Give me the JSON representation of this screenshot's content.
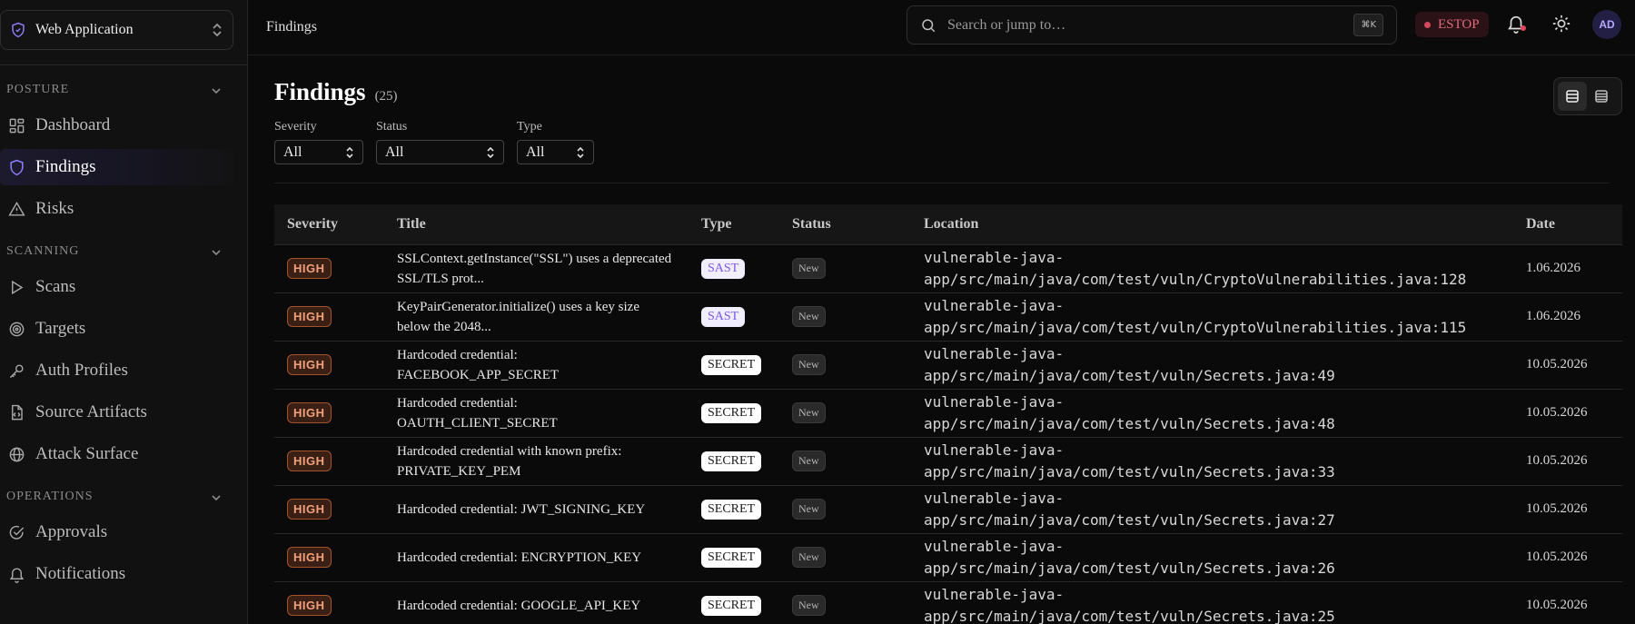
{
  "sidebar": {
    "app_name": "Web Application",
    "sections": [
      {
        "label": "POSTURE",
        "items": [
          {
            "label": "Dashboard",
            "icon": "grid-icon",
            "active": false
          },
          {
            "label": "Findings",
            "icon": "shield-icon",
            "active": true
          },
          {
            "label": "Risks",
            "icon": "warning-icon",
            "active": false
          }
        ]
      },
      {
        "label": "SCANNING",
        "items": [
          {
            "label": "Scans",
            "icon": "play-icon",
            "active": false
          },
          {
            "label": "Targets",
            "icon": "target-icon",
            "active": false
          },
          {
            "label": "Auth Profiles",
            "icon": "key-icon",
            "active": false
          },
          {
            "label": "Source Artifacts",
            "icon": "file-code-icon",
            "active": false
          },
          {
            "label": "Attack Surface",
            "icon": "globe-icon",
            "active": false
          }
        ]
      },
      {
        "label": "OPERATIONS",
        "items": [
          {
            "label": "Approvals",
            "icon": "check-circle-icon",
            "active": false
          },
          {
            "label": "Notifications",
            "icon": "bell-icon",
            "active": false
          }
        ]
      }
    ]
  },
  "topbar": {
    "breadcrumb": "Findings",
    "search_placeholder": "Search or jump to…",
    "search_shortcut": "⌘K",
    "estop_label": "ESTOP",
    "avatar_initials": "AD"
  },
  "page": {
    "title": "Findings",
    "count": "(25)"
  },
  "filters": [
    {
      "label": "Severity",
      "value": "All"
    },
    {
      "label": "Status",
      "value": "All"
    },
    {
      "label": "Type",
      "value": "All"
    }
  ],
  "table": {
    "columns": [
      "Severity",
      "Title",
      "Type",
      "Status",
      "Location",
      "Date"
    ],
    "rows": [
      {
        "severity": "HIGH",
        "title": "SSLContext.getInstance(\"SSL\") uses a deprecated SSL/TLS prot...",
        "type": "SAST",
        "status": "New",
        "location": "vulnerable-java-app/src/main/java/com/test/vuln/CryptoVulnerabilities.java:128",
        "date": "1.06.2026"
      },
      {
        "severity": "HIGH",
        "title": "KeyPairGenerator.initialize() uses a key size below the 2048...",
        "type": "SAST",
        "status": "New",
        "location": "vulnerable-java-app/src/main/java/com/test/vuln/CryptoVulnerabilities.java:115",
        "date": "1.06.2026"
      },
      {
        "severity": "HIGH",
        "title": "Hardcoded credential: FACEBOOK_APP_SECRET",
        "type": "SECRET",
        "status": "New",
        "location": "vulnerable-java-app/src/main/java/com/test/vuln/Secrets.java:49",
        "date": "10.05.2026"
      },
      {
        "severity": "HIGH",
        "title": "Hardcoded credential: OAUTH_CLIENT_SECRET",
        "type": "SECRET",
        "status": "New",
        "location": "vulnerable-java-app/src/main/java/com/test/vuln/Secrets.java:48",
        "date": "10.05.2026"
      },
      {
        "severity": "HIGH",
        "title": "Hardcoded credential with known prefix: PRIVATE_KEY_PEM",
        "type": "SECRET",
        "status": "New",
        "location": "vulnerable-java-app/src/main/java/com/test/vuln/Secrets.java:33",
        "date": "10.05.2026"
      },
      {
        "severity": "HIGH",
        "title": "Hardcoded credential: JWT_SIGNING_KEY",
        "type": "SECRET",
        "status": "New",
        "location": "vulnerable-java-app/src/main/java/com/test/vuln/Secrets.java:27",
        "date": "10.05.2026"
      },
      {
        "severity": "HIGH",
        "title": "Hardcoded credential: ENCRYPTION_KEY",
        "type": "SECRET",
        "status": "New",
        "location": "vulnerable-java-app/src/main/java/com/test/vuln/Secrets.java:26",
        "date": "10.05.2026"
      },
      {
        "severity": "HIGH",
        "title": "Hardcoded credential: GOOGLE_API_KEY",
        "type": "SECRET",
        "status": "New",
        "location": "vulnerable-java-app/src/main/java/com/test/vuln/Secrets.java:25",
        "date": "10.05.2026"
      }
    ]
  },
  "colors": {
    "accent": "#8b7cf6",
    "estop": "#e06b7c",
    "severity_high": "#f3a17a"
  }
}
